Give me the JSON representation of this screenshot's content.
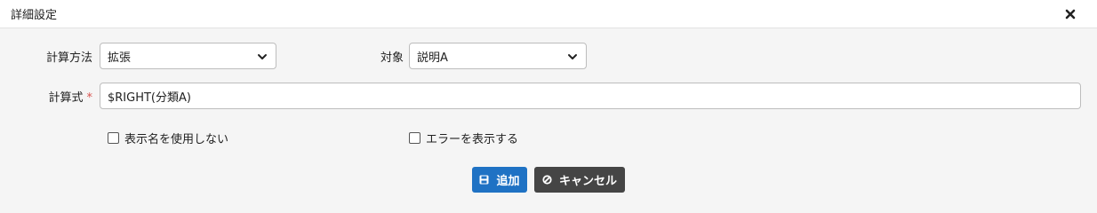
{
  "dialog": {
    "title": "詳細設定"
  },
  "form": {
    "calc_method": {
      "label": "計算方法",
      "value": "拡張"
    },
    "target": {
      "label": "対象",
      "value": "説明A"
    },
    "formula": {
      "label": "計算式",
      "required_mark": "*",
      "value": "$RIGHT(分類A)"
    },
    "hide_display_name": {
      "label": "表示名を使用しない",
      "checked": false
    },
    "show_errors": {
      "label": "エラーを表示する",
      "checked": false
    }
  },
  "buttons": {
    "add": "追加",
    "cancel": "キャンセル"
  },
  "colors": {
    "primary": "#1f72c4",
    "dark": "#454545",
    "required": "#d9534f"
  }
}
